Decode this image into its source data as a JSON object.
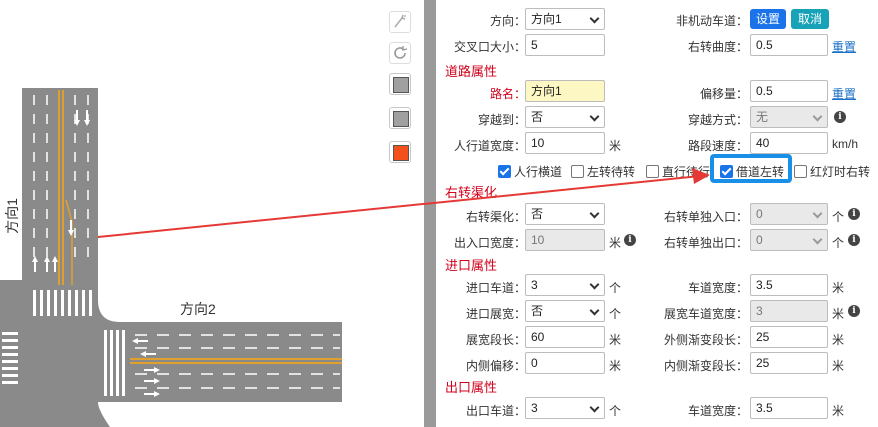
{
  "canvas": {
    "direction1_label": "方向1",
    "direction2_label": "方向2",
    "colors": {
      "road": "#8a8a8a",
      "lane_line": "#ffffff",
      "center_line": "#e0a030",
      "arrow": "#d93025"
    }
  },
  "toolbar": {
    "icons": [
      "magic-edit-icon",
      "refresh-icon",
      "gray-square-icon",
      "gray-square-icon",
      "orange-square-icon"
    ]
  },
  "panel": {
    "row_direction": {
      "label": "方向：",
      "value": "方向1"
    },
    "nonmotor": {
      "label": "非机动车道：",
      "set_label": "设置",
      "cancel_label": "取消"
    },
    "intersection_size": {
      "label": "交叉口大小：",
      "value": "5"
    },
    "right_curve": {
      "label": "右转曲度：",
      "value": "0.5",
      "reset": "重置"
    },
    "road_section": {
      "title": "道路属性"
    },
    "road_name": {
      "label": "路名：",
      "value": "方向1"
    },
    "offset": {
      "label": "偏移量：",
      "value": "0.5",
      "reset": "重置"
    },
    "cross_to": {
      "label": "穿越到：",
      "value": "否"
    },
    "cross_mode": {
      "label": "穿越方式：",
      "value": "无"
    },
    "sidewalk_width": {
      "label": "人行道宽度：",
      "value": "10",
      "unit": "米"
    },
    "road_speed": {
      "label": "路段速度：",
      "value": "40",
      "unit": "km/h"
    },
    "checkboxes": [
      {
        "label": "人行横道",
        "checked": true
      },
      {
        "label": "左转待转",
        "checked": false
      },
      {
        "label": "直行待行",
        "checked": false
      },
      {
        "label": "借道左转",
        "checked": true
      },
      {
        "label": "红灯时右转",
        "checked": false
      }
    ],
    "right_channel_section": {
      "title": "右转渠化"
    },
    "right_channel": {
      "label": "右转渠化：",
      "value": "否"
    },
    "right_only_in": {
      "label": "右转单独入口：",
      "value": "0",
      "unit": "个"
    },
    "io_width": {
      "label": "出入口宽度：",
      "value": "10",
      "unit": "米"
    },
    "right_only_out": {
      "label": "右转单独出口：",
      "value": "0",
      "unit": "个"
    },
    "entry_section": {
      "title": "进口属性"
    },
    "entry_lanes": {
      "label": "进口车道：",
      "value": "3",
      "unit": "个"
    },
    "entry_lane_width": {
      "label": "车道宽度：",
      "value": "3.5",
      "unit": "米"
    },
    "entry_widen": {
      "label": "进口展宽：",
      "value": "否",
      "unit": "个"
    },
    "widen_lane_width": {
      "label": "展宽车道宽度：",
      "value": "3",
      "unit": "米"
    },
    "widen_length": {
      "label": "展宽段长：",
      "value": "60",
      "unit": "米"
    },
    "outer_taper": {
      "label": "外侧渐变段长：",
      "value": "25",
      "unit": "米"
    },
    "inner_offset": {
      "label": "内侧偏移：",
      "value": "0",
      "unit": "米"
    },
    "inner_taper": {
      "label": "内侧渐变段长：",
      "value": "25",
      "unit": "米"
    },
    "exit_section": {
      "title": "出口属性"
    },
    "exit_lanes": {
      "label": "出口车道：",
      "value": "3",
      "unit": "个"
    },
    "exit_lane_width": {
      "label": "车道宽度：",
      "value": "3.5",
      "unit": "米"
    }
  }
}
